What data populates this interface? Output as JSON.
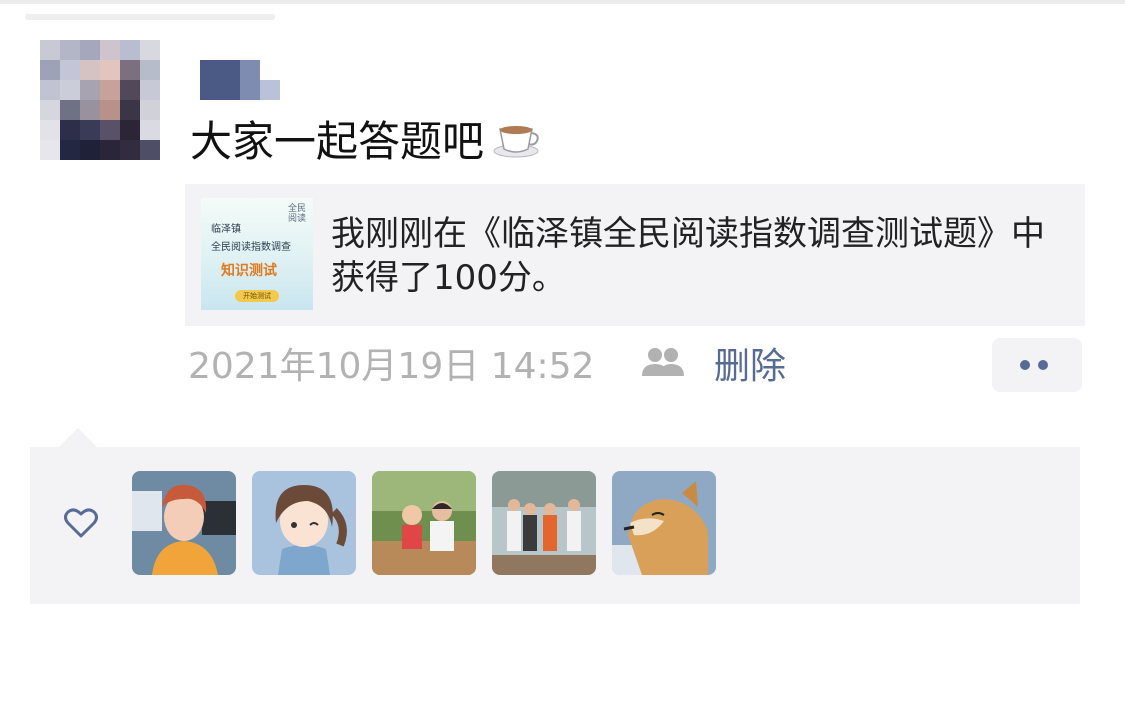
{
  "post": {
    "text": "大家一起答题吧",
    "emoji_icon": "coffee-cup-icon"
  },
  "link_card": {
    "title": "我刚刚在《临泽镇全民阅读指数调查测试题》中获得了100分。",
    "thumbnail": {
      "line1": "临泽镇",
      "line2": "全民阅读指数调查",
      "headline": "知识测试",
      "button": "开始测试"
    }
  },
  "meta": {
    "timestamp": "2021年10月19日 14:52",
    "visibility_icon": "friends-icon",
    "delete_label": "删除"
  },
  "likes": {
    "icon": "heart-icon",
    "avatars": [
      "woman-orange-avatar",
      "cartoon-girl-avatar",
      "family-photo-avatar",
      "group-photo-avatar",
      "shiba-dog-avatar"
    ]
  },
  "colors": {
    "link_blue": "#576b95",
    "meta_gray": "#b2b2b2",
    "panel_bg": "#f3f3f5"
  }
}
